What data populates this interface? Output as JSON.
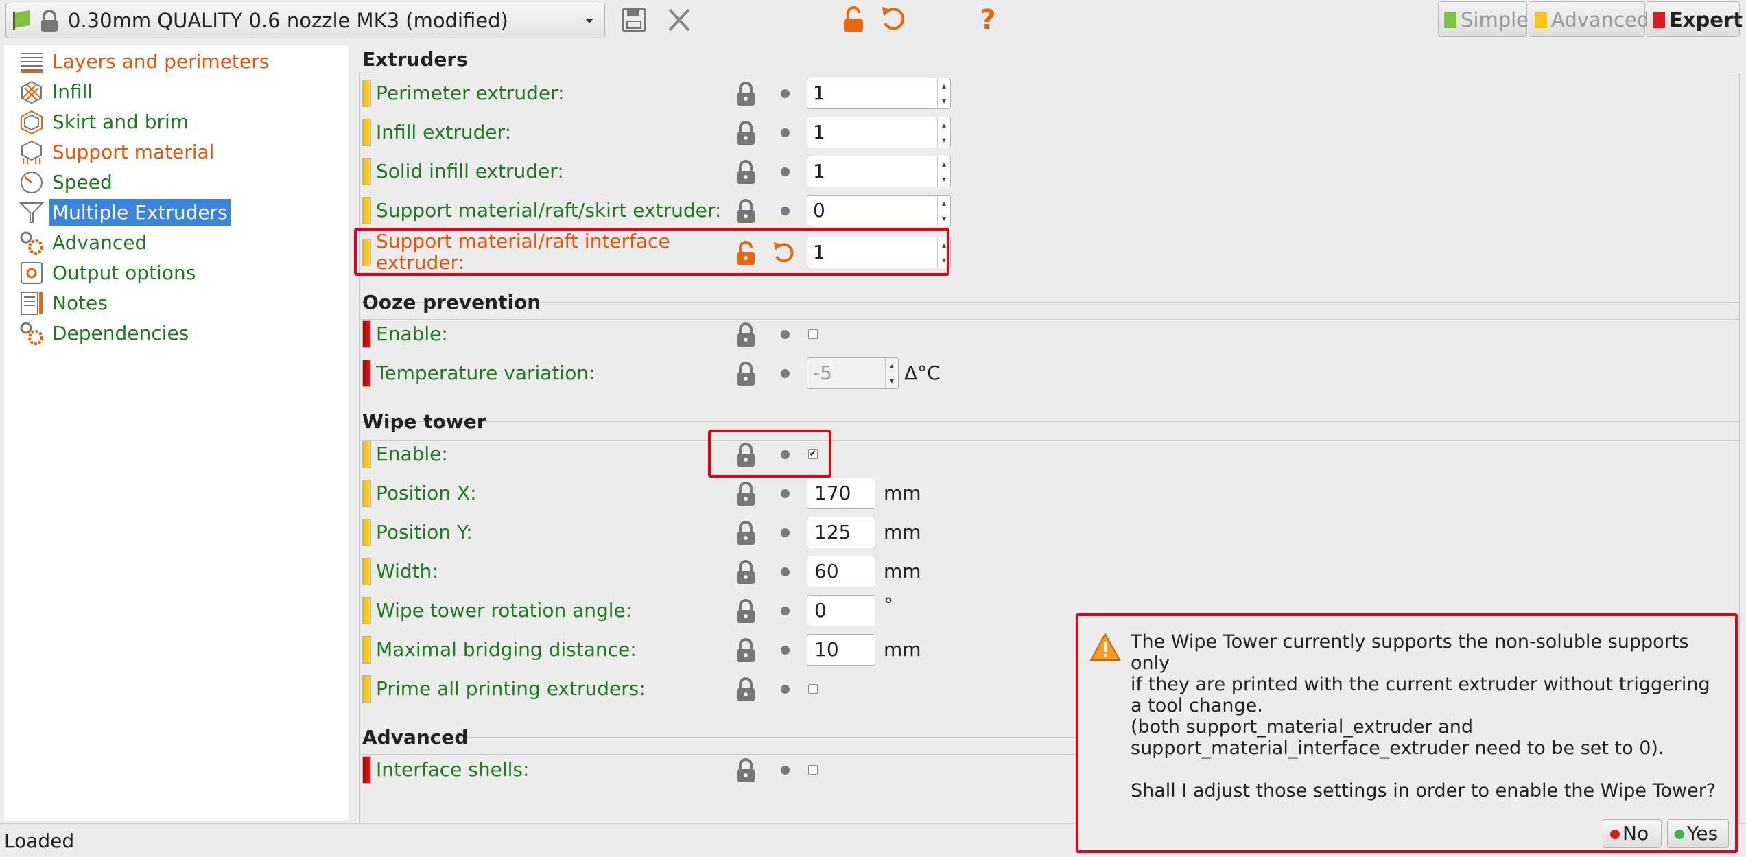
{
  "toolbar": {
    "preset_name": "0.30mm QUALITY 0.6 nozzle MK3 (modified)",
    "icons": [
      "save-icon",
      "delete-icon",
      "lock-open-icon",
      "undo-icon",
      "help-icon"
    ],
    "modes": [
      {
        "label": "Simple",
        "color": "#7fc241",
        "active": false
      },
      {
        "label": "Advanced",
        "color": "#f5c518",
        "active": false
      },
      {
        "label": "Expert",
        "color": "#d81e1e",
        "active": true
      }
    ]
  },
  "sidebar": {
    "items": [
      {
        "label": "Layers and perimeters",
        "icon": "layers-icon",
        "color": "orange"
      },
      {
        "label": "Infill",
        "icon": "infill-icon",
        "color": "green"
      },
      {
        "label": "Skirt and brim",
        "icon": "skirt-brim-icon",
        "color": "green"
      },
      {
        "label": "Support material",
        "icon": "support-icon",
        "color": "orange"
      },
      {
        "label": "Speed",
        "icon": "speed-icon",
        "color": "green"
      },
      {
        "label": "Multiple Extruders",
        "icon": "funnel-icon",
        "color": "selected"
      },
      {
        "label": "Advanced",
        "icon": "gears-icon",
        "color": "green"
      },
      {
        "label": "Output options",
        "icon": "output-icon",
        "color": "green"
      },
      {
        "label": "Notes",
        "icon": "notes-icon",
        "color": "green"
      },
      {
        "label": "Dependencies",
        "icon": "gears-icon",
        "color": "green"
      }
    ]
  },
  "groups": {
    "extruders": {
      "title": "Extruders",
      "rows": [
        {
          "label": "Perimeter extruder:",
          "value": "1"
        },
        {
          "label": "Infill extruder:",
          "value": "1"
        },
        {
          "label": "Solid infill extruder:",
          "value": "1"
        },
        {
          "label": "Support material/raft/skirt extruder:",
          "value": "0"
        },
        {
          "label_line1": "Support material/raft interface",
          "label_line2": "extruder:",
          "value": "1"
        }
      ]
    },
    "ooze": {
      "title": "Ooze prevention",
      "rows": [
        {
          "label": "Enable:"
        },
        {
          "label": "Temperature variation:",
          "value": "-5",
          "unit": "Δ°C"
        }
      ]
    },
    "wipe": {
      "title": "Wipe tower",
      "rows": [
        {
          "label": "Enable:",
          "checked": "✔"
        },
        {
          "label": "Position X:",
          "value": "170",
          "unit": "mm"
        },
        {
          "label": "Position Y:",
          "value": "125",
          "unit": "mm"
        },
        {
          "label": "Width:",
          "value": "60",
          "unit": "mm"
        },
        {
          "label": "Wipe tower rotation angle:",
          "value": "0",
          "unit": "°"
        },
        {
          "label": "Maximal bridging distance:",
          "value": "10",
          "unit": "mm"
        },
        {
          "label": "Prime all printing extruders:"
        }
      ]
    },
    "advanced": {
      "title": "Advanced",
      "rows": [
        {
          "label": "Interface shells:"
        }
      ]
    }
  },
  "status": {
    "text": "Loaded"
  },
  "dialog": {
    "lines": [
      "The Wipe Tower currently supports the non-soluble supports",
      "only",
      "if they are printed with the current extruder without triggering",
      "a tool change.",
      "(both support_material_extruder and",
      "support_material_interface_extruder need to be set to 0).",
      "",
      "Shall I adjust those settings in order to enable the Wipe Tower?"
    ],
    "no_label": "No",
    "yes_label": "Yes"
  }
}
